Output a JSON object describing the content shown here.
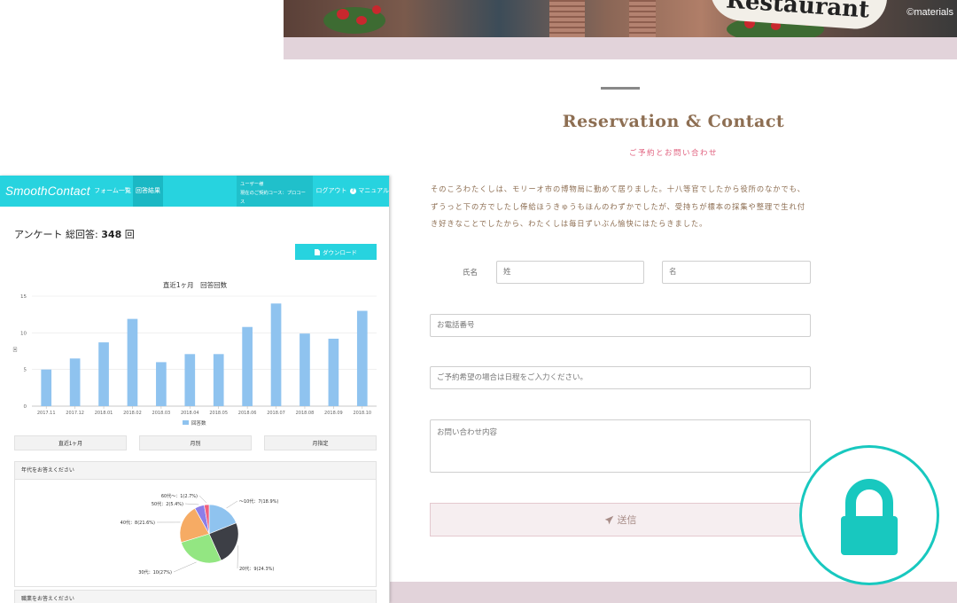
{
  "site": {
    "hero_sign": "Restaurant",
    "hero_credit": "©materials",
    "title": "Reservation & Contact",
    "subtitle": "ご予約とお問い合わせ",
    "intro": "そのころわたくしは、モリーオ市の博物局に勤めて居りました。十八等官でしたから役所のなかでも、ずうっと下の方でしたし俸給ほうきゅうもほんのわずかでしたが、受持ちが標本の採集や整理で生れ付き好きなことでしたから、わたくしは毎日ずいぶん愉快にはたらきました。"
  },
  "form": {
    "name_label": "氏名",
    "last_name_placeholder": "姓",
    "first_name_placeholder": "名",
    "phone_placeholder": "お電話番号",
    "date_placeholder": "ご予約希望の場合は日程をご入力ください。",
    "message_placeholder": "お問い合わせ内容",
    "send_label": "送信"
  },
  "lock_badge": {
    "icon": "lock-icon",
    "color": "#18c8bf"
  },
  "dashboard": {
    "brand": "SmoothContact",
    "nav": {
      "forms": "フォーム一覧",
      "results": "回答結果",
      "user_line1": "ユーザー様",
      "user_line2": "現在のご契約コース：プロコース",
      "logout": "ログアウト",
      "manual": "マニュアル"
    },
    "survey_label": "アンケート 総回答:",
    "survey_count": "348",
    "survey_unit": "回",
    "download_label": "ダウンロード",
    "period_buttons": [
      "直近1ヶ月",
      "月別",
      "月指定"
    ],
    "age_question": "年代をお答えください",
    "job_question": "職業をお答えください",
    "accent": "#27d3df"
  },
  "chart_data": [
    {
      "type": "bar",
      "title": "直近1ヶ月　回答回数",
      "ylabel": "回",
      "categories": [
        "2017.11",
        "2017.12",
        "2018.01",
        "2018.02",
        "2018.03",
        "2018.04",
        "2018.05",
        "2018.06",
        "2018.07",
        "2018.08",
        "2018.09",
        "2018.10"
      ],
      "series": [
        {
          "name": "回答数",
          "values": [
            5,
            6.5,
            8.7,
            11.9,
            6,
            7.1,
            7.1,
            10.8,
            14,
            9.9,
            9.2,
            13
          ]
        }
      ],
      "ylim": [
        0,
        15
      ],
      "yticks": [
        0,
        5,
        10,
        15
      ],
      "grid": true,
      "legend": "bottom",
      "color": "#8fc3ef"
    },
    {
      "type": "pie",
      "title": "",
      "slices": [
        {
          "label": "〜10代：7(18.9%)",
          "value": 7,
          "color": "#8fc3ef"
        },
        {
          "label": "20代：9(24.3%)",
          "value": 9,
          "color": "#3d3f46"
        },
        {
          "label": "30代：10(27%)",
          "value": 10,
          "color": "#93e682"
        },
        {
          "label": "40代：8(21.6%)",
          "value": 8,
          "color": "#f6ab64"
        },
        {
          "label": "50代：2(5.4%)",
          "value": 2,
          "color": "#8c7ee8"
        },
        {
          "label": "60代〜：1(2.7%)",
          "value": 1,
          "color": "#f0607e"
        }
      ]
    }
  ]
}
